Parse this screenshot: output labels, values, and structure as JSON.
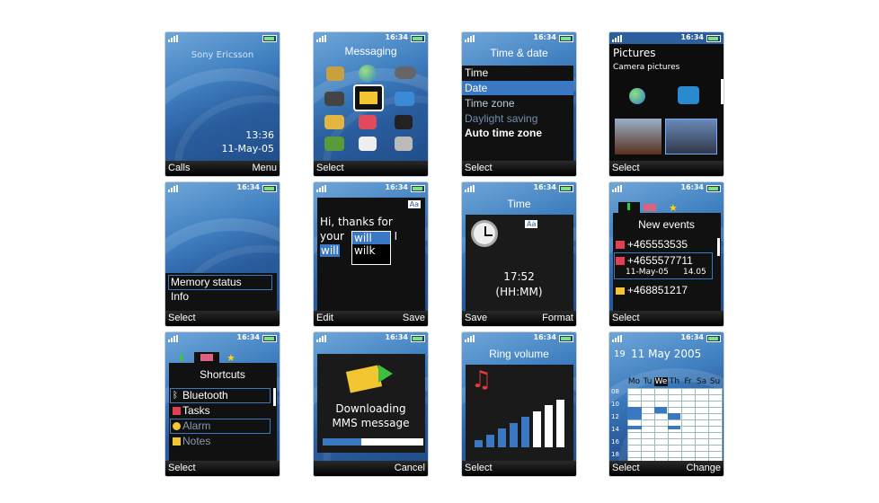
{
  "status": {
    "time": "16:34"
  },
  "screens": {
    "standby": {
      "brand": "Sony Ericsson",
      "time": "13:36",
      "date": "11-May-05",
      "left": "Calls",
      "right": "Menu"
    },
    "messaging": {
      "title": "Messaging",
      "left": "Select"
    },
    "timedate": {
      "title": "Time & date",
      "items": [
        "Time",
        "Date",
        "Time zone",
        "Daylight saving",
        "Auto time zone"
      ],
      "left": "Select"
    },
    "pictures": {
      "title": "Pictures",
      "subtitle": "Camera pictures",
      "left": "Select"
    },
    "memory": {
      "items": [
        "Memory status",
        "Info"
      ],
      "left": "Select"
    },
    "edit": {
      "text1": "Hi, thanks for",
      "text2": "your",
      "text3": ". I",
      "typed": "will",
      "badge": "Aa",
      "options": [
        "will",
        "wilk"
      ],
      "left": "Edit",
      "right": "Save"
    },
    "time": {
      "title": "Time",
      "badge": "Aa",
      "value": "17:52",
      "format": "(HH:MM)",
      "left": "Save",
      "right": "Format"
    },
    "events": {
      "title": "New events",
      "items": [
        "+465553535",
        "+4655577711",
        "+468851217"
      ],
      "sub_date": "11-May-05",
      "sub_time": "14.05",
      "left": "Select"
    },
    "shortcuts": {
      "title": "Shortcuts",
      "items": [
        "Bluetooth",
        "Tasks",
        "Alarm",
        "Notes"
      ],
      "left": "Select"
    },
    "download": {
      "line1": "Downloading",
      "line2": "MMS message",
      "progress": 0.38,
      "right": "Cancel"
    },
    "ring": {
      "title": "Ring volume",
      "level": 8,
      "max": 8,
      "left": "Select"
    },
    "calendar": {
      "week": "19",
      "title": "11 May 2005",
      "days": [
        "Mo",
        "Tu",
        "We",
        "Th",
        "Fr",
        "Sa",
        "Su"
      ],
      "hours": [
        "08",
        "10",
        "12",
        "14",
        "16",
        "18"
      ],
      "left": "Select",
      "right": "Change"
    }
  },
  "colors": {
    "accent": "#3a78c4",
    "dark": "#111111",
    "sky": "#4a8bd0"
  },
  "icons": [
    "signal-icon",
    "battery-icon",
    "envelope-icon",
    "camera-icon",
    "gamepad-icon",
    "globe-icon",
    "clock-icon",
    "music-note-icon",
    "bluetooth-icon",
    "alarm-icon",
    "phone-icon"
  ]
}
